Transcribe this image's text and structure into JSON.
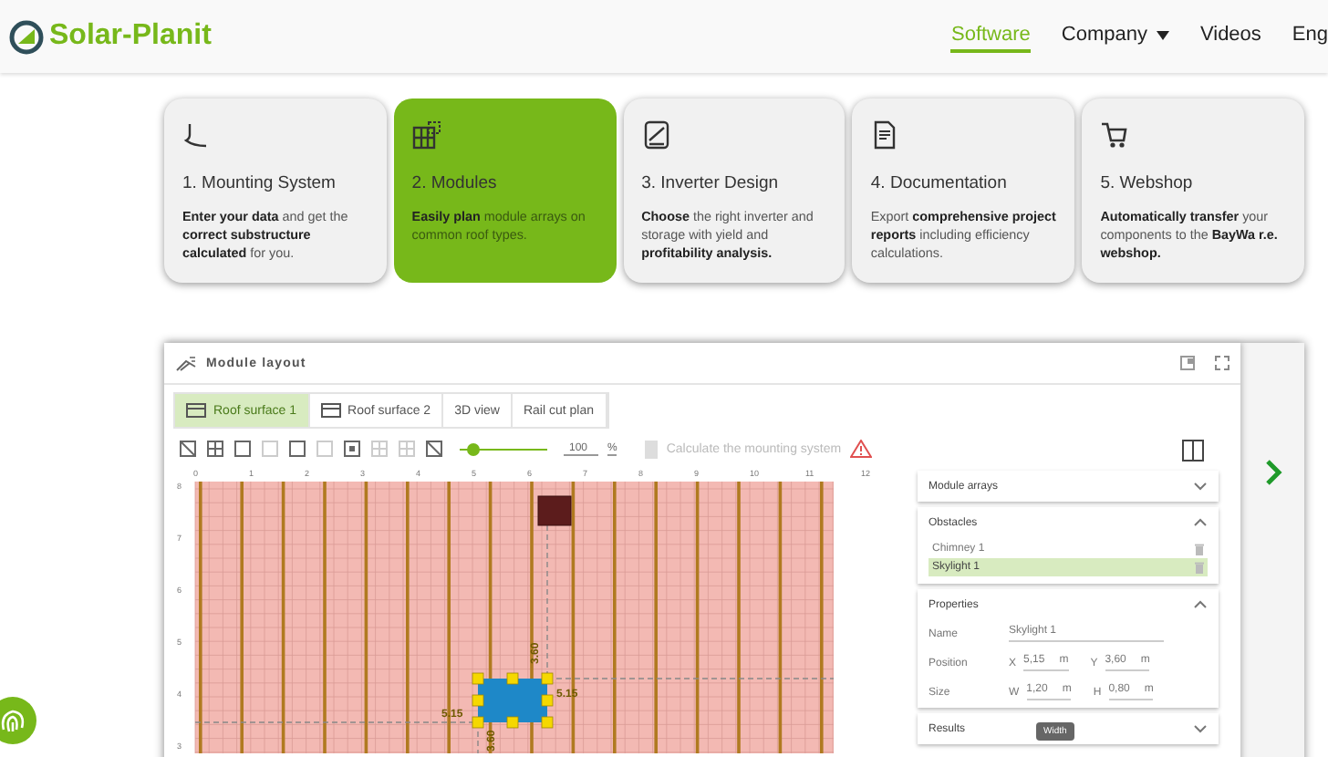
{
  "header": {
    "logo": "Solar-Planit",
    "nav": [
      {
        "label": "Software",
        "selected": true,
        "dropdown": false
      },
      {
        "label": "Company",
        "selected": false,
        "dropdown": true
      },
      {
        "label": "Videos",
        "selected": false,
        "dropdown": false
      },
      {
        "label": "Eng",
        "selected": false,
        "dropdown": false
      }
    ]
  },
  "steps": [
    {
      "title": "1. Mounting System",
      "description": "**Enter your data** and get the **correct substructure calculated** for you.",
      "selected": false,
      "kind": "mounting"
    },
    {
      "title": "2. Modules",
      "description": "**Easily plan** module arrays on common roof types.",
      "selected": true,
      "kind": "modules"
    },
    {
      "title": "3. Inverter Design",
      "description": "**Choose** the right inverter and storage with yield and **profitability analysis.**",
      "selected": false,
      "kind": "inverter"
    },
    {
      "title": "4. Documentation",
      "description": "Export **comprehensive project reports** including efficiency calculations.",
      "selected": false,
      "kind": "document"
    },
    {
      "title": "5. Webshop",
      "description": "**Automatically transfer** your components to the **BayWa r.e. webshop.**",
      "selected": false,
      "kind": "cart"
    }
  ],
  "app": {
    "title": "Module layout",
    "tabs": [
      {
        "label": "Roof surface 1",
        "selected": true,
        "has_icon": true
      },
      {
        "label": "Roof surface 2",
        "selected": false,
        "has_icon": true
      },
      {
        "label": "3D view",
        "selected": false,
        "has_icon": false
      },
      {
        "label": "Rail cut plan",
        "selected": false,
        "has_icon": false
      }
    ],
    "toolbar": {
      "zoom": {
        "level": 0.15,
        "value": "100",
        "unit": "%"
      },
      "calculate": {
        "label": "Calculate the mounting system",
        "disabled": true
      },
      "warning": true
    },
    "canvas": {
      "x_ticks": [
        "0",
        "1",
        "2",
        "3",
        "4",
        "5",
        "6",
        "7",
        "8",
        "9",
        "10",
        "11",
        "12"
      ],
      "y_ticks": [
        "8",
        "7",
        "6",
        "5",
        "4",
        "3"
      ],
      "dimension_labels": [
        "3.60",
        "5.15",
        "5.15",
        "3.60"
      ]
    },
    "panel": {
      "sections": [
        {
          "kind": "list",
          "title": "Module arrays",
          "expanded": false
        },
        {
          "kind": "list",
          "title": "Obstacles",
          "expanded": true,
          "items": [
            {
              "label": "Chimney 1",
              "selected": false
            },
            {
              "label": "Skylight 1",
              "selected": true
            }
          ]
        },
        {
          "kind": "properties",
          "title": "Properties",
          "expanded": true,
          "name": {
            "label": "Name",
            "value": "Skylight 1"
          },
          "rows": [
            {
              "label": "Position",
              "fields": [
                {
                  "axis": "X",
                  "value": "5,15",
                  "unit": "m"
                },
                {
                  "axis": "Y",
                  "value": "3,60",
                  "unit": "m"
                }
              ]
            },
            {
              "label": "Size",
              "fields": [
                {
                  "axis": "W",
                  "value": "1,20",
                  "unit": "m"
                },
                {
                  "axis": "H",
                  "value": "0,80",
                  "unit": "m"
                }
              ]
            }
          ]
        },
        {
          "kind": "list",
          "title": "Results",
          "expanded": false
        }
      ]
    },
    "tooltip": "Width"
  }
}
